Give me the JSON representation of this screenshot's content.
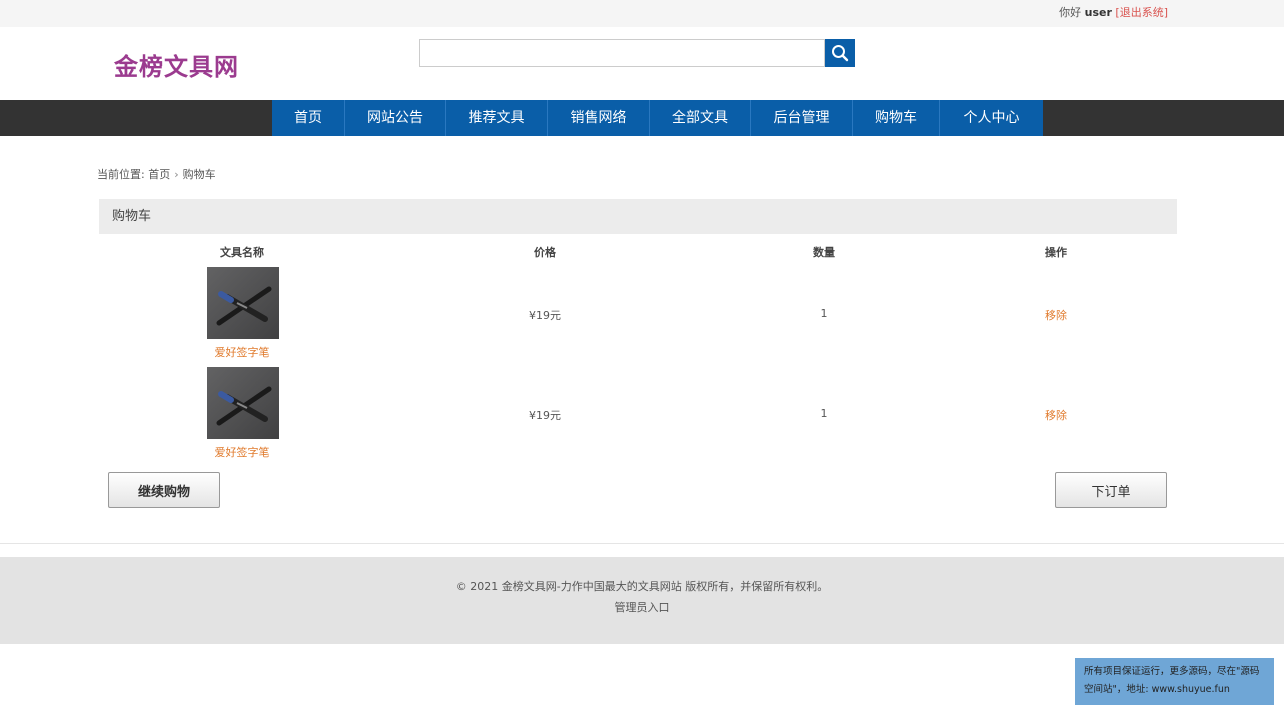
{
  "topbar": {
    "greeting": "你好",
    "username": "user",
    "logout": "[退出系统]"
  },
  "header": {
    "logo": "金榜文具网",
    "search": {
      "placeholder": "",
      "value": ""
    }
  },
  "nav": {
    "items": [
      "首页",
      "网站公告",
      "推荐文具",
      "销售网络",
      "全部文具",
      "后台管理",
      "购物车",
      "个人中心"
    ]
  },
  "breadcrumb": {
    "prefix": "当前位置:",
    "home": "首页",
    "current": "购物车"
  },
  "cart": {
    "title": "购物车",
    "columns": [
      "文具名称",
      "价格",
      "数量",
      "操作"
    ],
    "rows": [
      {
        "name": "爱好签字笔",
        "price": "¥19元",
        "quantity": "1",
        "action": "移除"
      },
      {
        "name": "爱好签字笔",
        "price": "¥19元",
        "quantity": "1",
        "action": "移除"
      }
    ],
    "continue_label": "继续购物",
    "order_label": "下订单"
  },
  "footer": {
    "copyright": "© 2021 金榜文具网-力作中国最大的文具网站 版权所有，并保留所有权利。",
    "admin_link": "管理员入口"
  },
  "promo": {
    "line1": "所有项目保证运行，更多源码，尽在\"源码",
    "line2": "空间站\"，地址: www.shuyue.fun"
  },
  "colors": {
    "nav_blue": "#0a5ea8",
    "nav_dark": "#333333",
    "logo_purple": "#9b3b8f",
    "link_orange": "#e07a2c",
    "logout_red": "#d9534f"
  }
}
